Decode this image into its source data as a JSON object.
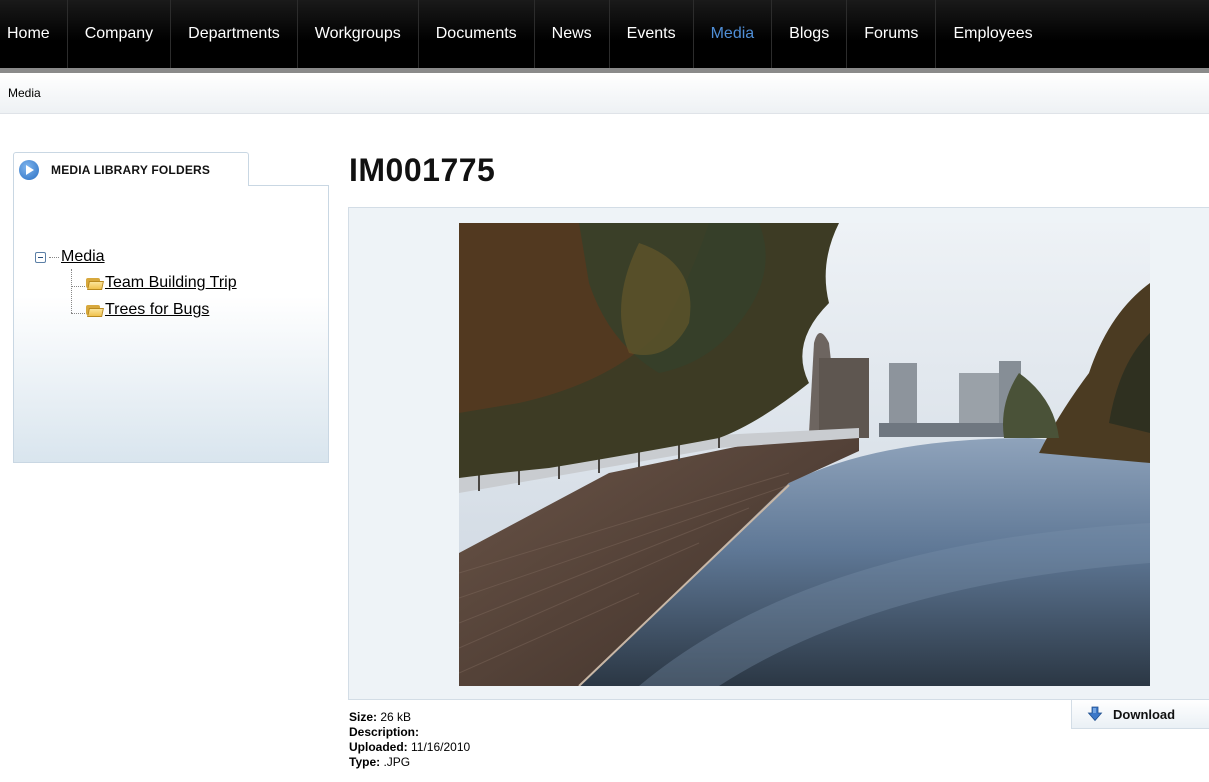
{
  "nav": {
    "items": [
      {
        "label": "Home"
      },
      {
        "label": "Company"
      },
      {
        "label": "Departments"
      },
      {
        "label": "Workgroups"
      },
      {
        "label": "Documents"
      },
      {
        "label": "News"
      },
      {
        "label": "Events"
      },
      {
        "label": "Media",
        "active": true
      },
      {
        "label": "Blogs"
      },
      {
        "label": "Forums"
      },
      {
        "label": "Employees"
      }
    ],
    "active_color": "#4f8ed6"
  },
  "breadcrumb": {
    "current": "Media"
  },
  "folders": {
    "tab_label": "MEDIA LIBRARY FOLDERS",
    "tab_icon": "arrow-circle-icon",
    "root": {
      "label": "Media",
      "expand_icon": "minus-box-icon"
    },
    "children": [
      {
        "label": "Team Building Trip",
        "icon": "folder-icon"
      },
      {
        "label": "Trees for Bugs",
        "icon": "folder-icon"
      }
    ]
  },
  "media": {
    "title": "IM001775",
    "download_label": "Download",
    "download_icon": "download-arrow-icon",
    "meta": {
      "size_label": "Size:",
      "size_value": "26 kB",
      "description_label": "Description:",
      "description_value": "",
      "uploaded_label": "Uploaded:",
      "uploaded_value": "11/16/2010",
      "type_label": "Type:",
      "type_value": ".JPG"
    }
  }
}
